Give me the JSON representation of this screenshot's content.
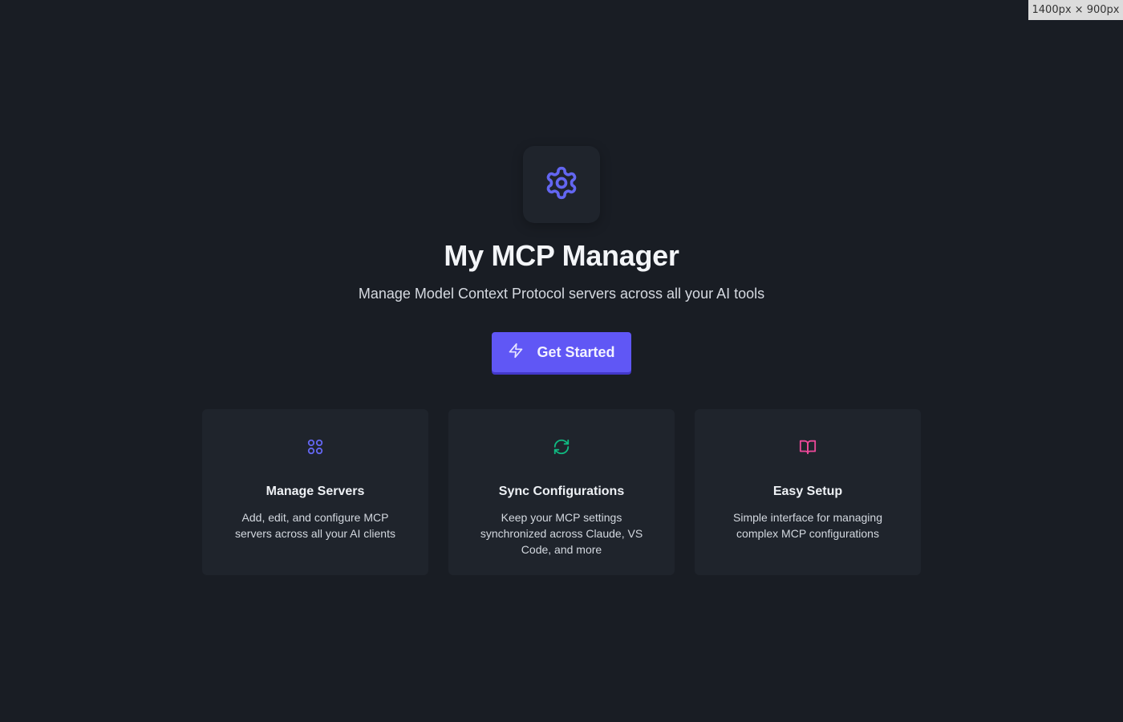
{
  "viewport_badge": "1400px × 900px",
  "hero": {
    "icon": "gear-icon",
    "title": "My MCP Manager",
    "subtitle": "Manage Model Context Protocol servers across all your AI tools",
    "cta_label": "Get Started",
    "cta_icon": "lightning-icon"
  },
  "features": [
    {
      "icon": "grid-icon",
      "title": "Manage Servers",
      "description": "Add, edit, and configure MCP servers across all your AI clients",
      "accent": "#6366f1"
    },
    {
      "icon": "refresh-icon",
      "title": "Sync Configurations",
      "description": "Keep your MCP settings synchronized across Claude, VS Code, and more",
      "accent": "#10b981"
    },
    {
      "icon": "book-icon",
      "title": "Easy Setup",
      "description": "Simple interface for managing complex MCP configurations",
      "accent": "#ec4899"
    }
  ],
  "colors": {
    "background": "#191d24",
    "card": "#1f242c",
    "primary": "#6057f5"
  }
}
